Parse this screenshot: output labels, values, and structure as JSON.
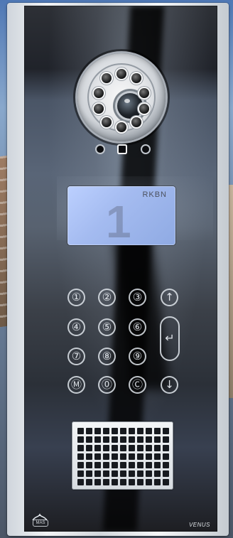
{
  "display": {
    "text": "RKBN",
    "number": "1"
  },
  "keypad": {
    "keys": [
      "①",
      "②",
      "③",
      "↑",
      "④",
      "⑤",
      "⑥",
      "⑦",
      "⑧",
      "⑨",
      "Ⓜ",
      "⓪",
      "Ⓒ",
      "↓"
    ],
    "enter": "↵"
  },
  "branding": {
    "model": "VENUS",
    "logo_text": "MAS"
  },
  "icons": {
    "camera": "camera-icon",
    "speaker": "speaker-grille-icon",
    "logo": "brand-logo-icon"
  },
  "colors": {
    "panel": "#2c3037",
    "display": "#a9c0f2",
    "frame": "#e7eaee"
  }
}
